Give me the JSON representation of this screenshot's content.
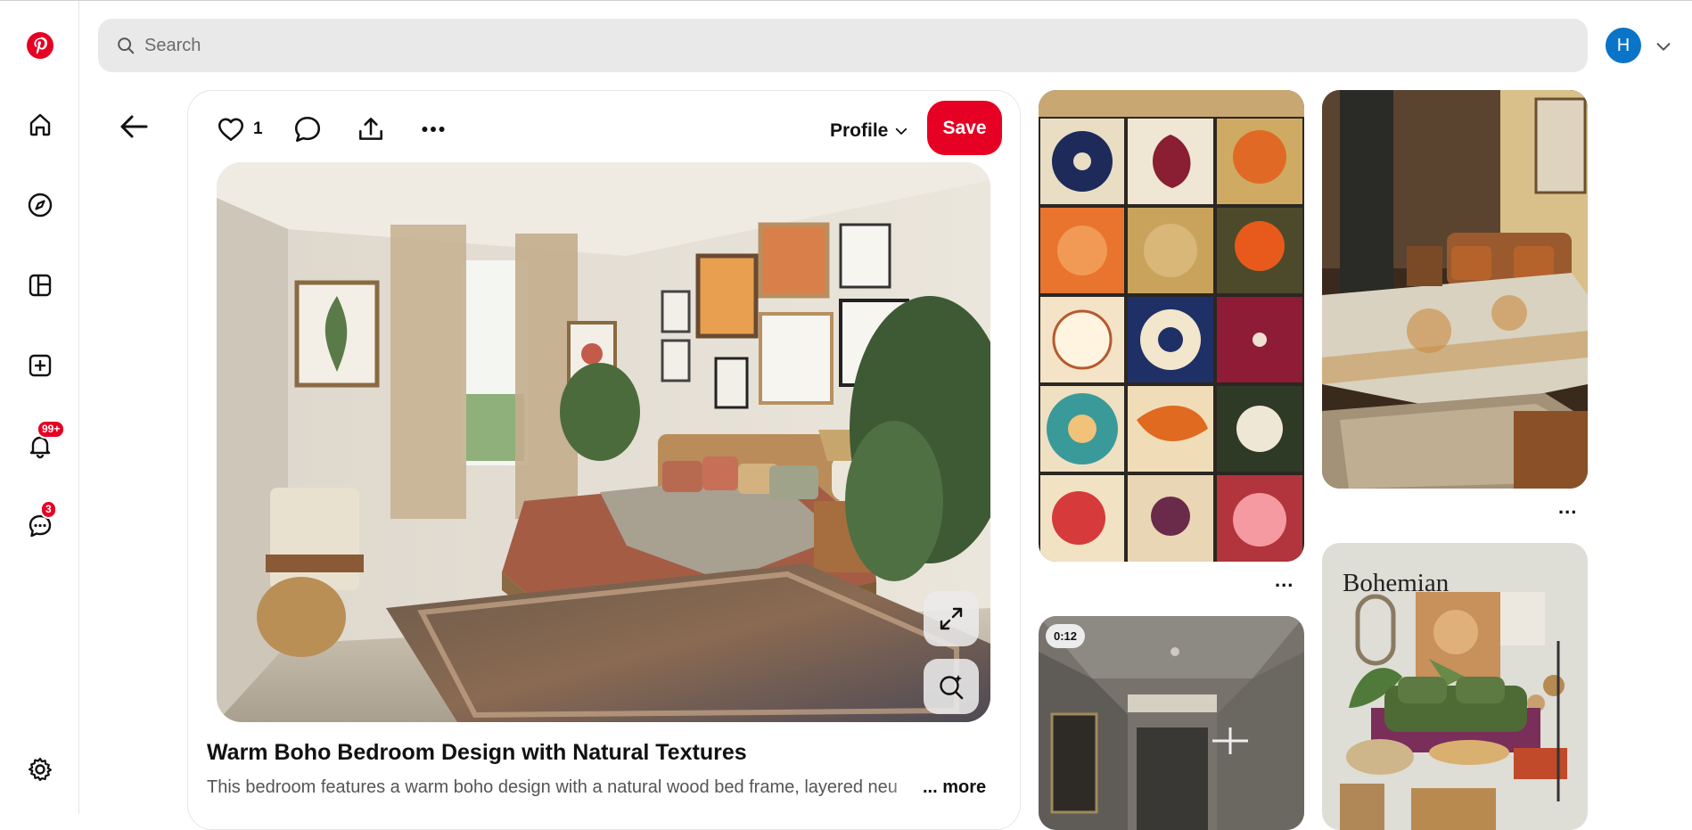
{
  "app": {
    "name": "Pinterest",
    "brand_color": "#e60023"
  },
  "header": {
    "search_placeholder": "Search",
    "avatar_initial": "H"
  },
  "sidebar": {
    "items": [
      {
        "name": "home",
        "icon": "home-icon"
      },
      {
        "name": "explore",
        "icon": "compass-icon"
      },
      {
        "name": "boards",
        "icon": "boards-icon"
      },
      {
        "name": "create",
        "icon": "plus-square-icon"
      },
      {
        "name": "notifications",
        "icon": "bell-icon",
        "badge": "99+"
      },
      {
        "name": "messages",
        "icon": "chat-icon",
        "badge": "3"
      }
    ],
    "settings_icon": "gear-icon"
  },
  "pin": {
    "like_count": "1",
    "profile_label": "Profile",
    "save_label": "Save",
    "title": "Warm Boho Bedroom Design with Natural Textures",
    "description": "This bedroom features a warm boho design with a natural wood bed frame, layered neu",
    "more_label": "... more"
  },
  "feed": {
    "tiles": [
      {
        "name": "floral-tiles-pin",
        "more": "..."
      },
      {
        "name": "bedroom-pin",
        "more": "..."
      },
      {
        "name": "hallway-video-pin",
        "duration": "0:12"
      },
      {
        "name": "bohemian-moodboard-pin",
        "label": "Bohemian"
      }
    ]
  }
}
